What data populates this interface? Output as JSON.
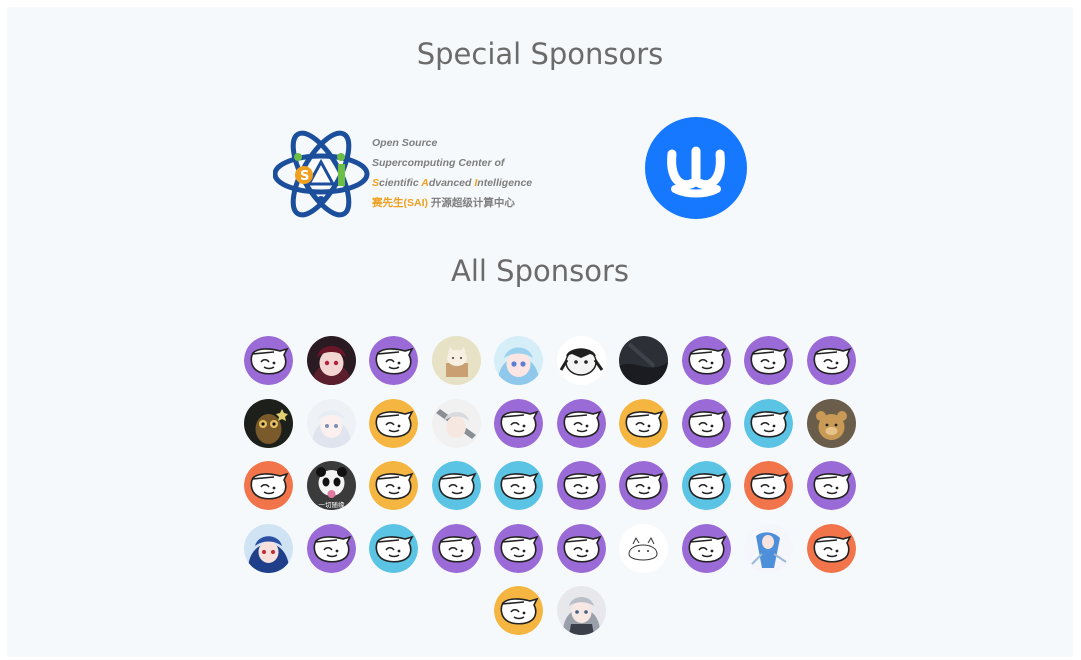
{
  "special_sponsors": {
    "title": "Special Sponsors",
    "sai": {
      "line1": "Open Source",
      "line2": "Supercomputing Center of",
      "line3": [
        "S",
        "cientific ",
        "A",
        "dvanced ",
        "I",
        "ntelligence"
      ],
      "line4_highlight": "赛先生(SAI)",
      "line4_rest": " 开源超级计算中心"
    },
    "second_logo_color": "#1677ff"
  },
  "all_sponsors": {
    "title": "All Sponsors",
    "colors": {
      "purple": "#9a6ad6",
      "yellow": "#f5b541",
      "blue": "#5bc3e3",
      "orange": "#f2744a"
    },
    "rows": [
      [
        "purple",
        "photo-anime-red",
        "purple",
        "photo-cat-box",
        "photo-anime-blue",
        "photo-dog-mask",
        "photo-dark-sky",
        "purple",
        "purple",
        "purple"
      ],
      [
        "photo-owl",
        "photo-anime-white",
        "yellow",
        "photo-anime-knight",
        "purple",
        "purple",
        "yellow",
        "purple",
        "blue",
        "photo-teddy-bear"
      ],
      [
        "orange",
        "photo-panda",
        "yellow",
        "blue",
        "blue",
        "purple",
        "purple",
        "blue",
        "orange",
        "purple"
      ],
      [
        "photo-anime-bluehair",
        "purple",
        "blue",
        "purple",
        "purple",
        "purple",
        "photo-sketch-cat",
        "purple",
        "photo-anime-dancer",
        "orange"
      ],
      [
        "yellow",
        "photo-anime-silver"
      ]
    ],
    "panda_caption": "一切随缘"
  }
}
